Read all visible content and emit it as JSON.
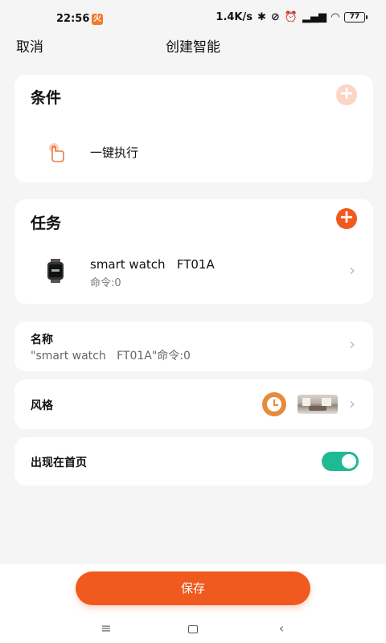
{
  "status_bar": {
    "time": "22:56",
    "notification_badge": "火",
    "network_speed": "1.4K/s",
    "battery": "77"
  },
  "header": {
    "cancel_label": "取消",
    "title": "创建智能"
  },
  "conditions": {
    "title": "条件",
    "add_icon": "plus-icon",
    "item_label": "一键执行",
    "item_icon": "tap-hand-icon"
  },
  "tasks": {
    "title": "任务",
    "add_icon": "plus-icon",
    "device_name": "smart watch   FT01A",
    "device_command": "命令:0",
    "device_icon": "smartwatch-icon"
  },
  "name_row": {
    "label": "名称",
    "value": "\"smart watch   FT01A\"命令:0"
  },
  "style_row": {
    "label": "风格",
    "icon": "clock-icon"
  },
  "homepage_row": {
    "label": "出现在首页",
    "enabled": true
  },
  "save_label": "保存",
  "colors": {
    "accent": "#f05a1f",
    "toggle_on": "#1fba94",
    "background": "#f5f5f5"
  }
}
